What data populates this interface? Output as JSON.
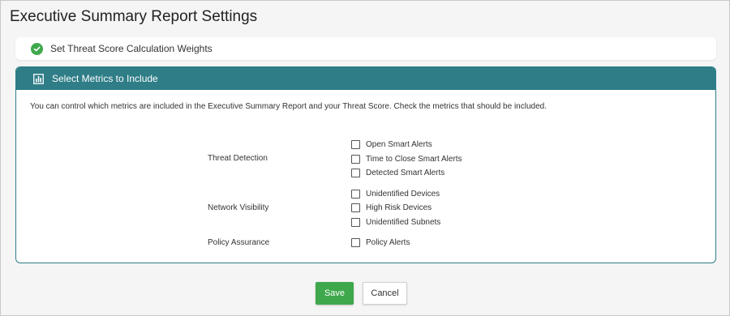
{
  "page": {
    "title": "Executive Summary Report Settings"
  },
  "steps": {
    "weights": {
      "label": "Set Threat Score Calculation Weights",
      "icon": "check-circle-icon",
      "status_color": "#3fa84c"
    },
    "metrics": {
      "label": "Select Metrics to Include",
      "icon": "bar-chart-icon",
      "header_color": "#2e7d87"
    }
  },
  "description": "You can control which metrics are included in the Executive Summary Report and your Threat Score. Check the metrics that should be included.",
  "groups": [
    {
      "label": "Threat Detection",
      "metrics": [
        "Open Smart Alerts",
        "Time to Close Smart Alerts",
        "Detected Smart Alerts"
      ]
    },
    {
      "label": "Network Visibility",
      "metrics": [
        "Unidentified Devices",
        "High Risk Devices",
        "Unidentified Subnets"
      ]
    },
    {
      "label": "Policy Assurance",
      "metrics": [
        "Policy Alerts"
      ]
    }
  ],
  "actions": {
    "save_label": "Save",
    "cancel_label": "Cancel",
    "save_color": "#3fa84c"
  }
}
